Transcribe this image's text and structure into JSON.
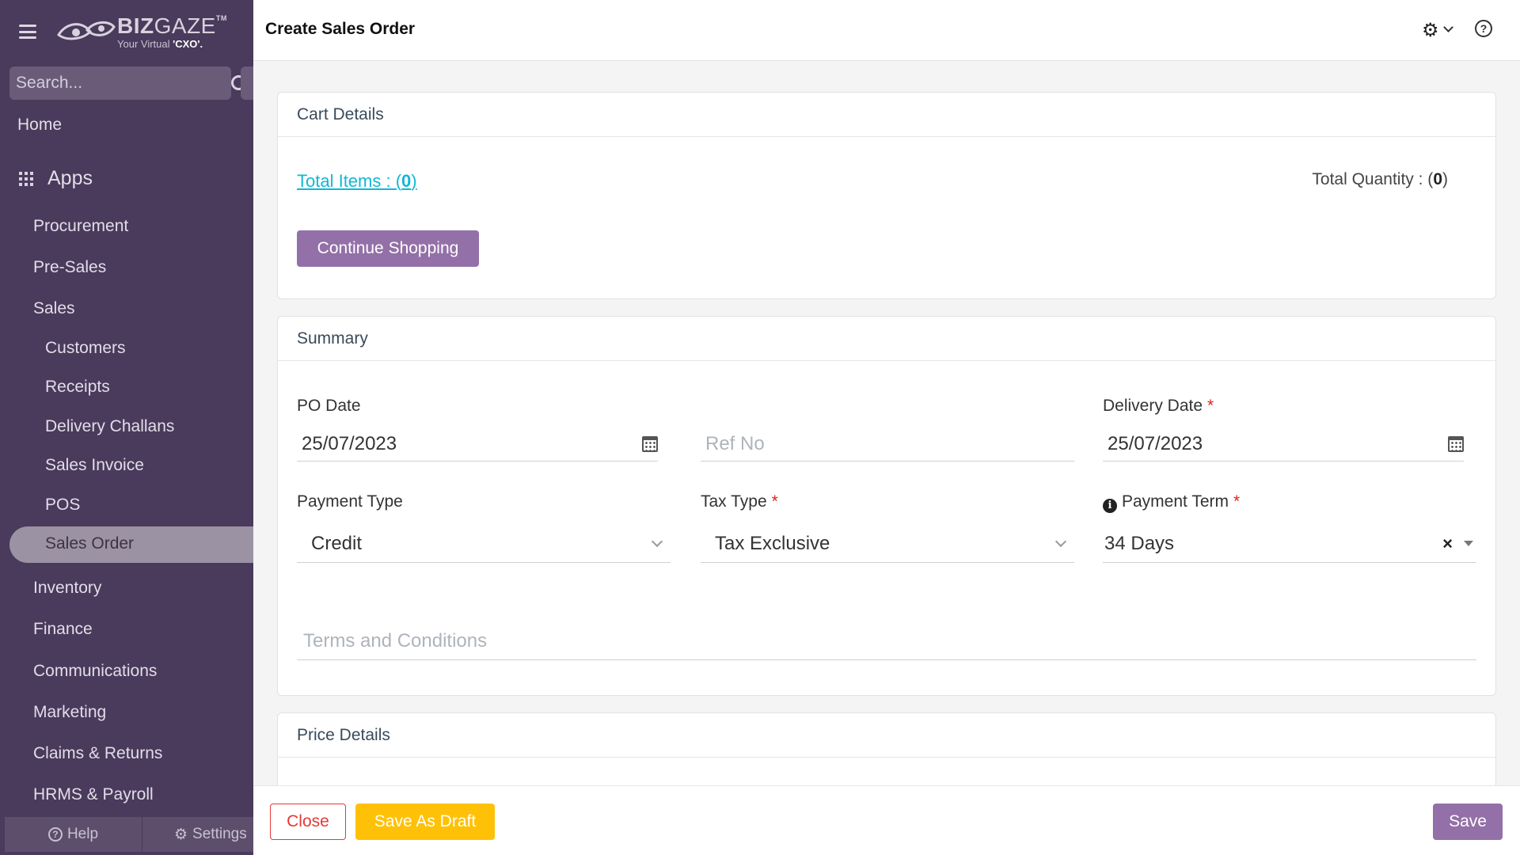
{
  "sidebar": {
    "logo": {
      "name_bold": "BIZ",
      "name_light": "GAZE",
      "tm": "TM",
      "tagline": "Your Virtual",
      "tagline_bold": "'CXO'."
    },
    "search_placeholder": "Search...",
    "home": "Home",
    "apps": "Apps",
    "items": [
      {
        "label": "Procurement"
      },
      {
        "label": "Pre-Sales"
      },
      {
        "label": "Sales"
      },
      {
        "label": "Customers"
      },
      {
        "label": "Receipts"
      },
      {
        "label": "Delivery Challans"
      },
      {
        "label": "Sales Invoice"
      },
      {
        "label": "POS"
      },
      {
        "label": "Sales Order"
      },
      {
        "label": "Inventory"
      },
      {
        "label": "Finance"
      },
      {
        "label": "Communications"
      },
      {
        "label": "Marketing"
      },
      {
        "label": "Claims & Returns"
      },
      {
        "label": "HRMS & Payroll"
      }
    ],
    "active_item": "Sales Order",
    "help": "Help",
    "settings": "Settings"
  },
  "header": {
    "title": "Create Sales Order",
    "icons": [
      "gear-icon",
      "chevron-down-icon",
      "help-icon"
    ]
  },
  "cart": {
    "title": "Cart Details",
    "total_items_label": "Total Items : (",
    "total_items_value": "0",
    "total_items_close": ")",
    "total_qty_label": "Total Quantity : (",
    "total_qty_value": "0",
    "total_qty_close": ")",
    "continue_button": "Continue Shopping"
  },
  "summary": {
    "title": "Summary",
    "po_date": {
      "label": "PO Date",
      "value": "25/07/2023"
    },
    "ref_no": {
      "placeholder": "Ref No"
    },
    "delivery_date": {
      "label": "Delivery Date",
      "required": "*",
      "value": "25/07/2023"
    },
    "payment_type": {
      "label": "Payment Type",
      "value": "Credit"
    },
    "tax_type": {
      "label": "Tax Type",
      "required": "*",
      "value": "Tax Exclusive"
    },
    "payment_term": {
      "label": "Payment Term",
      "required": "*",
      "value": "34 Days",
      "clear": "×"
    },
    "terms": {
      "placeholder": "Terms and Conditions"
    }
  },
  "price": {
    "title": "Price Details"
  },
  "footer": {
    "close": "Close",
    "save_draft": "Save As Draft",
    "save": "Save"
  },
  "colors": {
    "sidebar_bg": "#4a3a5c",
    "accent_purple": "#9370a7",
    "link_cyan": "#11b8d6",
    "draft_yellow": "#ffc107",
    "danger_red": "#e53935"
  }
}
